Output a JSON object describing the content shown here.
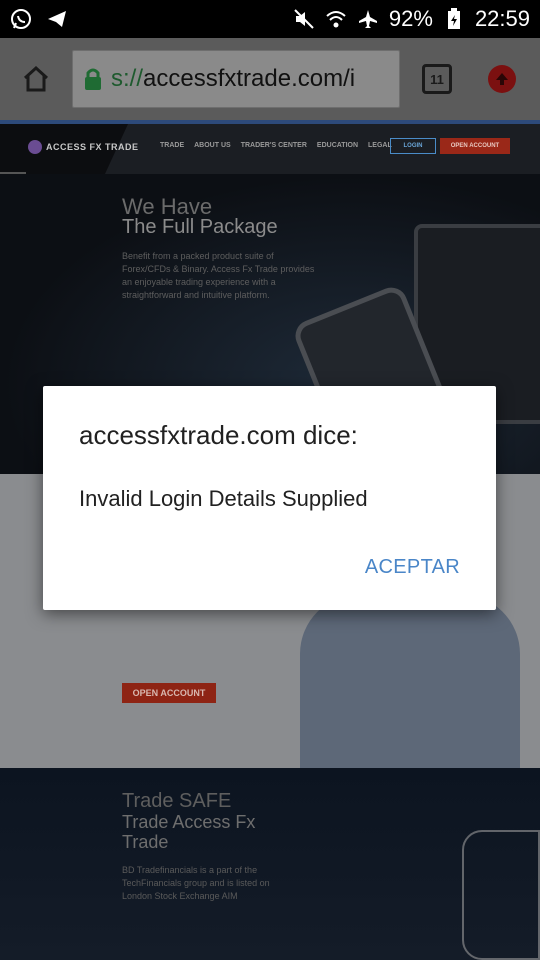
{
  "status_bar": {
    "battery_percent": "92%",
    "time": "22:59",
    "left_icons": [
      "whatsapp-icon",
      "telegram-icon"
    ],
    "right_icons": [
      "mute-icon",
      "wifi-icon",
      "airplane-icon",
      "battery-icon"
    ]
  },
  "browser": {
    "url_prefix": "s://",
    "url_main": "accessfxtrade.com/i",
    "tab_count": "11"
  },
  "site": {
    "logo_text": "ACCESS FX TRADE",
    "nav": [
      "TRADE",
      "ABOUT US",
      "TRADER'S CENTER",
      "EDUCATION",
      "LEGAL"
    ],
    "login_label": "LOGIN",
    "open_account_label": "OPEN ACCOUNT",
    "hero": {
      "title_line1": "We Have",
      "title_line2": "The Full Package",
      "body": "Benefit from a packed product suite of Forex/CFDs & Binary. Access Fx Trade provides an enjoyable trading experience with a straightforward and intuitive platform."
    },
    "section2": {
      "open_account_label": "OPEN ACCOUNT"
    },
    "section3": {
      "title_line1": "Trade SAFE",
      "title_line2": "Trade Access Fx Trade",
      "body": "BD Tradefinancials is a part of the TechFinancials group and is listed on London Stock Exchange AIM"
    }
  },
  "dialog": {
    "title": "accessfxtrade.com dice:",
    "message": "Invalid Login Details Supplied",
    "accept_label": "ACEPTAR"
  },
  "colors": {
    "dialog_button": "#4a86c8",
    "toolbar_dim": "#5b5b5b",
    "open_account": "#8e2414"
  }
}
